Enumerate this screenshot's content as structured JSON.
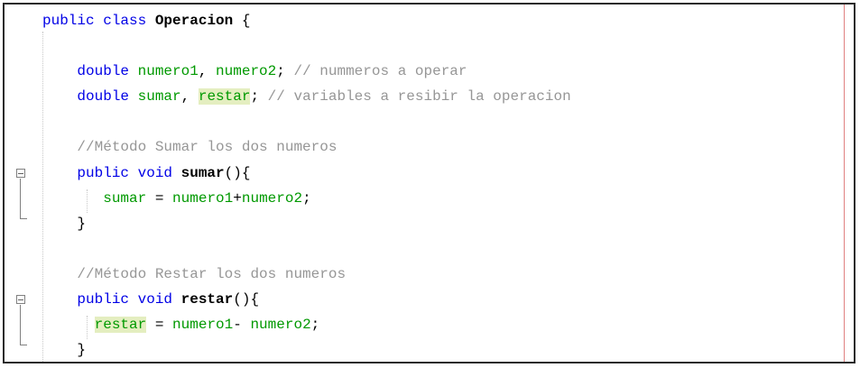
{
  "editor": {
    "lines": [
      {
        "tokens": [
          {
            "t": "public class ",
            "c": "kw"
          },
          {
            "t": "Operacion",
            "c": "cls"
          },
          {
            "t": " {",
            "c": "op"
          }
        ]
      },
      {
        "tokens": []
      },
      {
        "tokens": [
          {
            "t": "    ",
            "c": "op"
          },
          {
            "t": "double ",
            "c": "kw"
          },
          {
            "t": "numero1",
            "c": "fld"
          },
          {
            "t": ", ",
            "c": "op"
          },
          {
            "t": "numero2",
            "c": "fld"
          },
          {
            "t": "; ",
            "c": "op"
          },
          {
            "t": "// nummeros a operar",
            "c": "cm"
          }
        ]
      },
      {
        "tokens": [
          {
            "t": "    ",
            "c": "op"
          },
          {
            "t": "double ",
            "c": "kw"
          },
          {
            "t": "sumar",
            "c": "fld"
          },
          {
            "t": ", ",
            "c": "op"
          },
          {
            "t": "restar",
            "c": "fld hl"
          },
          {
            "t": "; ",
            "c": "op"
          },
          {
            "t": "// variables a resibir la operacion",
            "c": "cm"
          }
        ]
      },
      {
        "tokens": []
      },
      {
        "tokens": [
          {
            "t": "    ",
            "c": "op"
          },
          {
            "t": "//Método Sumar los dos numeros",
            "c": "cm"
          }
        ]
      },
      {
        "tokens": [
          {
            "t": "    ",
            "c": "op"
          },
          {
            "t": "public void ",
            "c": "kw"
          },
          {
            "t": "sumar",
            "c": "cls"
          },
          {
            "t": "(){",
            "c": "op"
          }
        ]
      },
      {
        "tokens": [
          {
            "t": "       ",
            "c": "op"
          },
          {
            "t": "sumar",
            "c": "fld"
          },
          {
            "t": " = ",
            "c": "op"
          },
          {
            "t": "numero1",
            "c": "fld"
          },
          {
            "t": "+",
            "c": "op"
          },
          {
            "t": "numero2",
            "c": "fld"
          },
          {
            "t": ";",
            "c": "op"
          }
        ]
      },
      {
        "tokens": [
          {
            "t": "    }",
            "c": "op"
          }
        ]
      },
      {
        "tokens": []
      },
      {
        "tokens": [
          {
            "t": "    ",
            "c": "op"
          },
          {
            "t": "//Método Restar los dos numeros",
            "c": "cm"
          }
        ]
      },
      {
        "tokens": [
          {
            "t": "    ",
            "c": "op"
          },
          {
            "t": "public void ",
            "c": "kw"
          },
          {
            "t": "restar",
            "c": "cls"
          },
          {
            "t": "(){",
            "c": "op"
          }
        ]
      },
      {
        "tokens": [
          {
            "t": "      ",
            "c": "op"
          },
          {
            "t": "restar",
            "c": "fld hl"
          },
          {
            "t": " = ",
            "c": "op"
          },
          {
            "t": "numero1",
            "c": "fld"
          },
          {
            "t": "- ",
            "c": "op"
          },
          {
            "t": "numero2",
            "c": "fld"
          },
          {
            "t": ";",
            "c": "op"
          }
        ]
      },
      {
        "tokens": [
          {
            "t": "    }",
            "c": "op"
          }
        ]
      }
    ],
    "colors": {
      "keyword": "#0000e6",
      "field": "#009900",
      "comment": "#969696",
      "highlight": "#e4eec0"
    },
    "icons": [
      "fold-collapse-icon",
      "fold-collapse-icon"
    ]
  }
}
